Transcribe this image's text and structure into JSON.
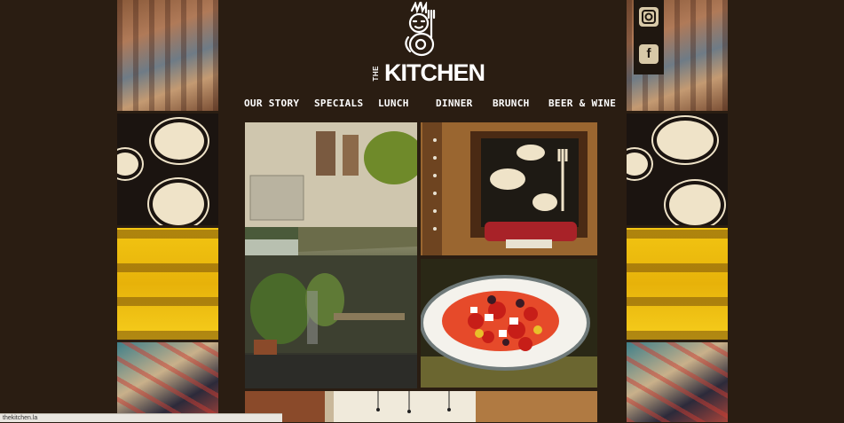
{
  "brand": {
    "logo_the": "THE",
    "logo_word": "KITCHEN"
  },
  "nav": {
    "items": [
      "OUR STORY",
      "SPECIALS",
      "LUNCH",
      "DINNER",
      "BRUNCH",
      "BEER & WINE"
    ]
  },
  "social": {
    "icons": [
      "instagram-icon",
      "facebook-icon"
    ],
    "facebook_glyph": "f"
  },
  "status_bar": {
    "url": "thekitchen.la"
  },
  "colors": {
    "background": "#2a1d12",
    "nav_text": "#ffffff",
    "mustard": "#f2c512"
  }
}
